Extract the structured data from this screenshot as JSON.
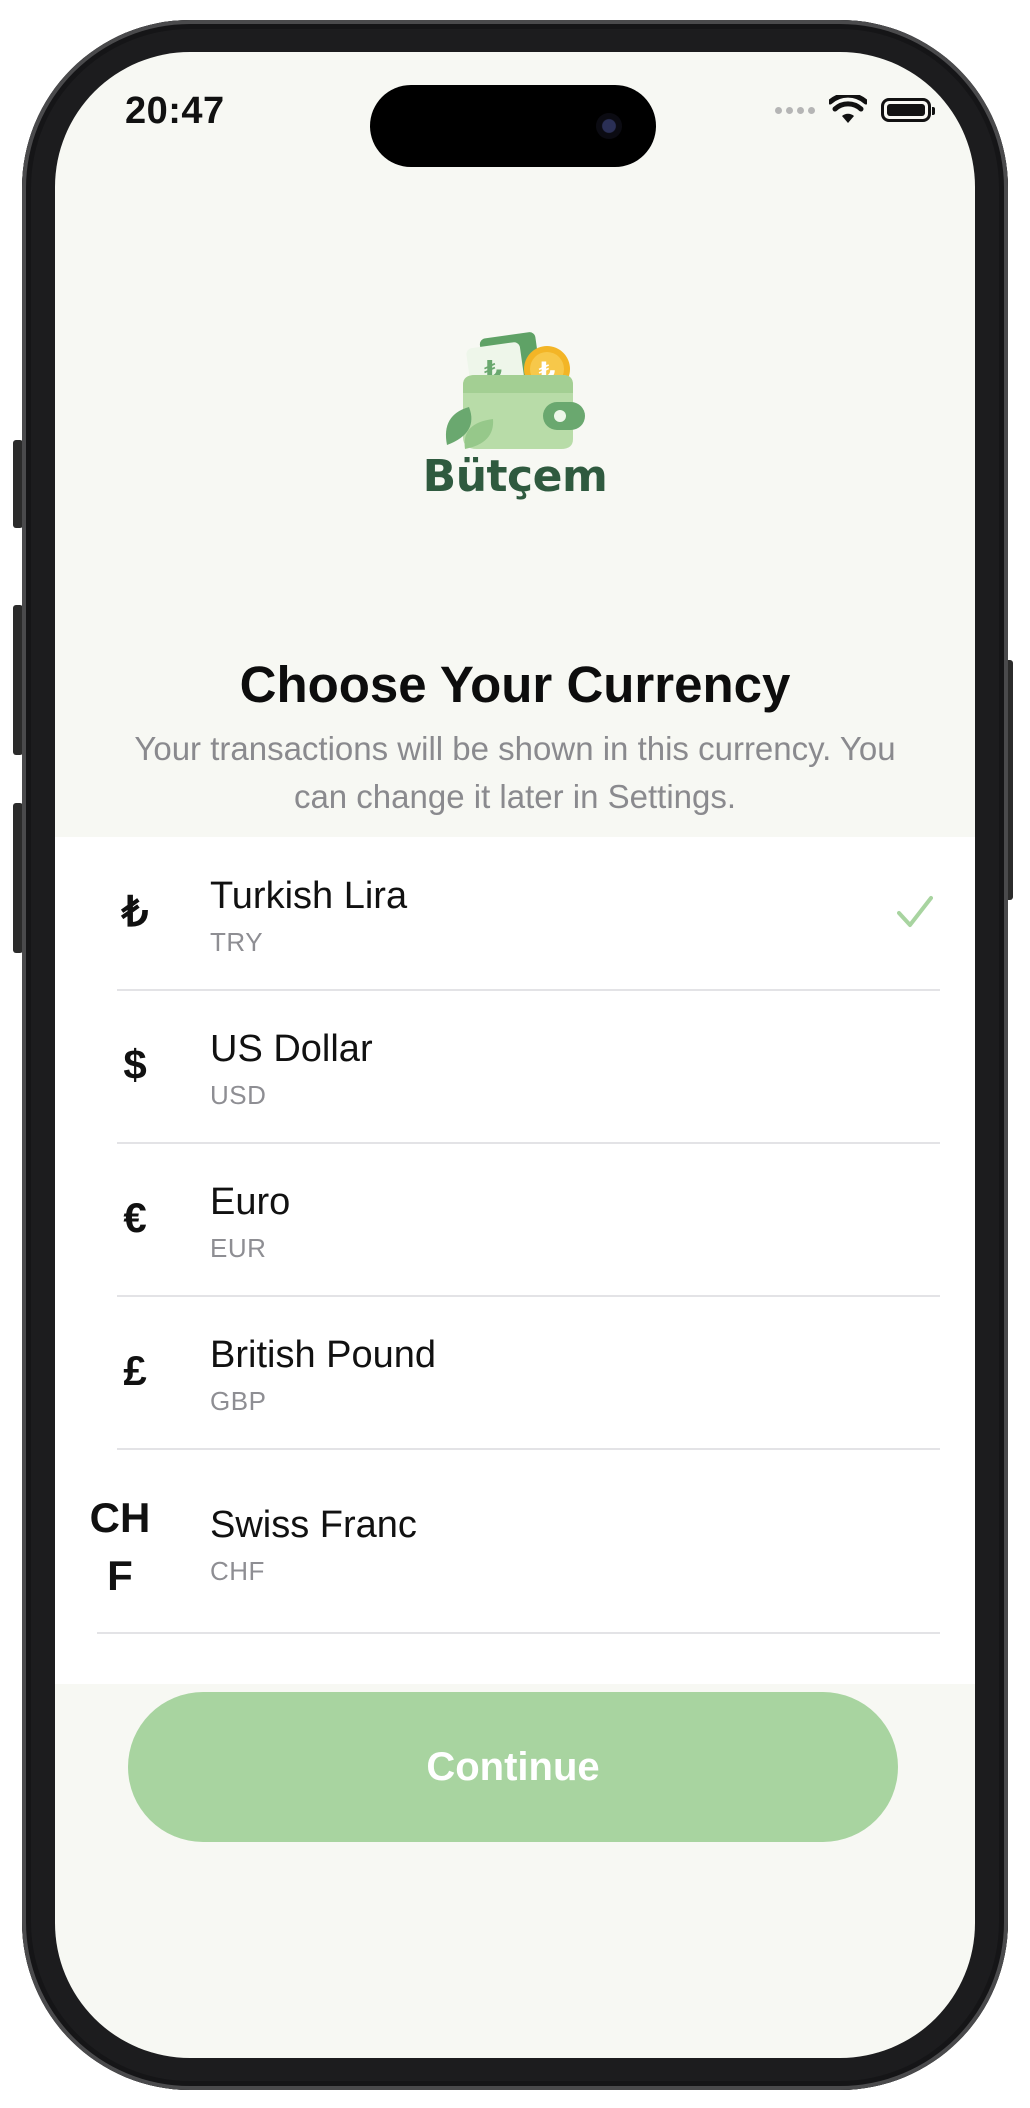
{
  "status_bar": {
    "time": "20:47"
  },
  "brand": {
    "name": "Bütçem",
    "coin_symbol": "₺",
    "accent": "#a8d4a0"
  },
  "header": {
    "title": "Choose Your Currency",
    "subtitle": "Your transactions will be shown in this currency. You can change it later in Settings."
  },
  "currencies": [
    {
      "symbol": "₺",
      "name": "Turkish Lira",
      "code": "TRY",
      "selected": true
    },
    {
      "symbol": "$",
      "name": "US Dollar",
      "code": "USD",
      "selected": false
    },
    {
      "symbol": "€",
      "name": "Euro",
      "code": "EUR",
      "selected": false
    },
    {
      "symbol": "£",
      "name": "British Pound",
      "code": "GBP",
      "selected": false
    },
    {
      "symbol": "CHF",
      "name": "Swiss Franc",
      "code": "CHF",
      "selected": false
    }
  ],
  "actions": {
    "continue_label": "Continue"
  }
}
